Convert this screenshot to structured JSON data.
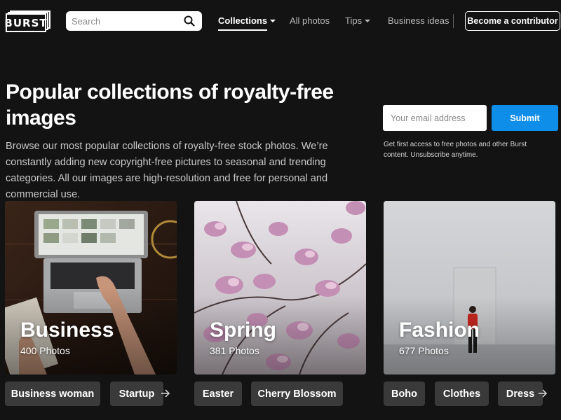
{
  "header": {
    "logo_text": "BURST",
    "search": {
      "placeholder": "Search",
      "value": ""
    },
    "nav": [
      {
        "label": "Collections",
        "active": true,
        "has_dropdown": true
      },
      {
        "label": "All photos",
        "active": false,
        "has_dropdown": false
      },
      {
        "label": "Tips",
        "active": false,
        "has_dropdown": true
      },
      {
        "label": "Business ideas",
        "active": false,
        "has_dropdown": false
      }
    ],
    "contributor_button": "Become a contributor"
  },
  "hero": {
    "title": "Popular collections of royalty-free images",
    "description": "Browse our most popular collections of royalty-free stock photos. We’re constantly adding new copyright-free pictures to seasonal and trending categories. All our images are high-resolution and free for personal and commercial use."
  },
  "newsletter": {
    "email_placeholder": "Your email address",
    "submit_label": "Submit",
    "note": "Get first access to free photos and other Burst content. Unsubscribe anytime."
  },
  "collections": [
    {
      "title": "Business",
      "count": "400 Photos",
      "tags": [
        "Business woman",
        "Startup"
      ]
    },
    {
      "title": "Spring",
      "count": "381 Photos",
      "tags": [
        "Easter",
        "Cherry Blossom"
      ]
    },
    {
      "title": "Fashion",
      "count": "677 Photos",
      "tags": [
        "Boho",
        "Clothes",
        "Dress"
      ]
    }
  ],
  "colors": {
    "background": "#131313",
    "accent": "#0f8ee9",
    "tag_bg": "#3a3a3a"
  },
  "icons": {
    "search": "search-icon",
    "caret": "chevron-down-icon",
    "scroll_arrow": "arrow-right-icon"
  }
}
